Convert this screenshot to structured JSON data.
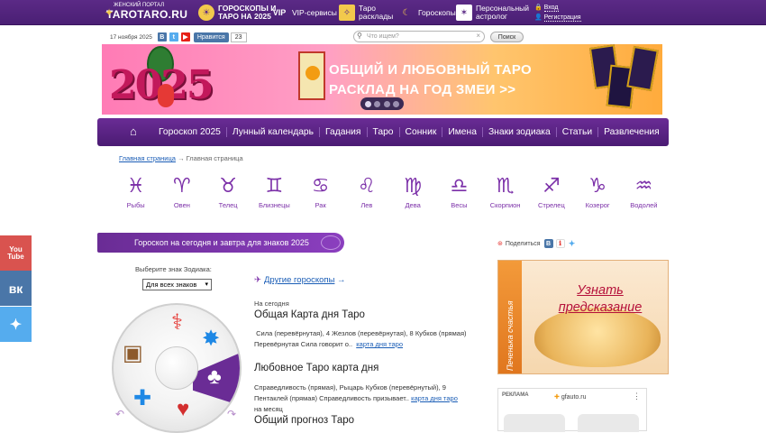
{
  "topbar": {
    "logo_small": "ЖЕНСКИЙ ПОРТАЛ",
    "logo_big": "TAROTARO.RU",
    "nav": [
      {
        "label1": "ГОРОСКОПЫ И",
        "label2": "ТАРО НА 2025",
        "icon": "sun-icon"
      },
      {
        "label1": "VIP-сервисы",
        "label2": "",
        "icon": "vip-icon"
      },
      {
        "label1": "Таро",
        "label2": "расклады",
        "icon": "tarot-icon"
      },
      {
        "label1": "Гороскопы",
        "label2": "",
        "icon": "moon-icon"
      },
      {
        "label1": "Персональный",
        "label2": "астролог",
        "icon": "astrologer-icon"
      }
    ],
    "login": "Вход",
    "register": "Регистрация"
  },
  "toolbar": {
    "date": "17 ноября 2025",
    "like_label": "Нравится",
    "like_count": "23",
    "search_placeholder": "Что ищем?",
    "search_button": "Поиск"
  },
  "banner": {
    "year": "2025",
    "line1": "ОБЩИЙ И ЛЮБОВНЫЙ ТАРО",
    "line2": "РАСКЛАД НА ГОД ЗМЕИ >>",
    "active_slide": 1,
    "slides": 4
  },
  "mainnav": [
    "Гороскоп 2025",
    "Лунный календарь",
    "Гадания",
    "Таро",
    "Сонник",
    "Имена",
    "Знаки зодиака",
    "Статьи",
    "Развлечения"
  ],
  "breadcrumb": {
    "home": "Главная страница",
    "sep": "→",
    "current": "Главная страница"
  },
  "zodiac": [
    {
      "sym": "♓",
      "name": "Рыбы"
    },
    {
      "sym": "♈",
      "name": "Овен"
    },
    {
      "sym": "♉",
      "name": "Телец"
    },
    {
      "sym": "♊",
      "name": "Близнецы"
    },
    {
      "sym": "♋",
      "name": "Рак"
    },
    {
      "sym": "♌",
      "name": "Лев"
    },
    {
      "sym": "♍",
      "name": "Дева"
    },
    {
      "sym": "♎",
      "name": "Весы"
    },
    {
      "sym": "♏",
      "name": "Скорпион"
    },
    {
      "sym": "♐",
      "name": "Стрелец"
    },
    {
      "sym": "♑",
      "name": "Козерог"
    },
    {
      "sym": "♒",
      "name": "Водолей"
    }
  ],
  "horoscope": {
    "header": "Гороскоп на сегодня и завтра для знаков 2025",
    "choose_label": "Выберите знак Зодиака:",
    "select_value": "Для всех знаков",
    "other_link": "Другие гороскопы",
    "other_arrow": "→",
    "today": "На сегодня",
    "card_title": "Общая Карта дня Таро",
    "card_text": "Сила (перевёрнутая), 4 Жезлов (перевёрнутая), 8 Кубков (прямая)",
    "card_text2": "Перевёрнутая Сила говорит о..",
    "card_link": "карта дня таро",
    "love_title": "Любовное Таро карта дня",
    "love_text": "Справедливость (прямая), Рыцарь Кубков (перевёрнутый), 9",
    "love_text2": "Пентаклей (прямая) Справедливость призывает..",
    "love_link": "карта дня таро",
    "month": "на месяц",
    "general_title": "Общий прогноз Таро"
  },
  "share": {
    "label": "Поделиться"
  },
  "cookie": {
    "side": "Печенька счастья",
    "cta1": "Узнать",
    "cta2": "предсказание"
  },
  "ad": {
    "label": "РЕКЛАМА",
    "source": "gfauto.ru"
  },
  "colors": {
    "brand": "#5b2a86",
    "accent": "#7b2fa8",
    "link": "#1a5db6"
  }
}
